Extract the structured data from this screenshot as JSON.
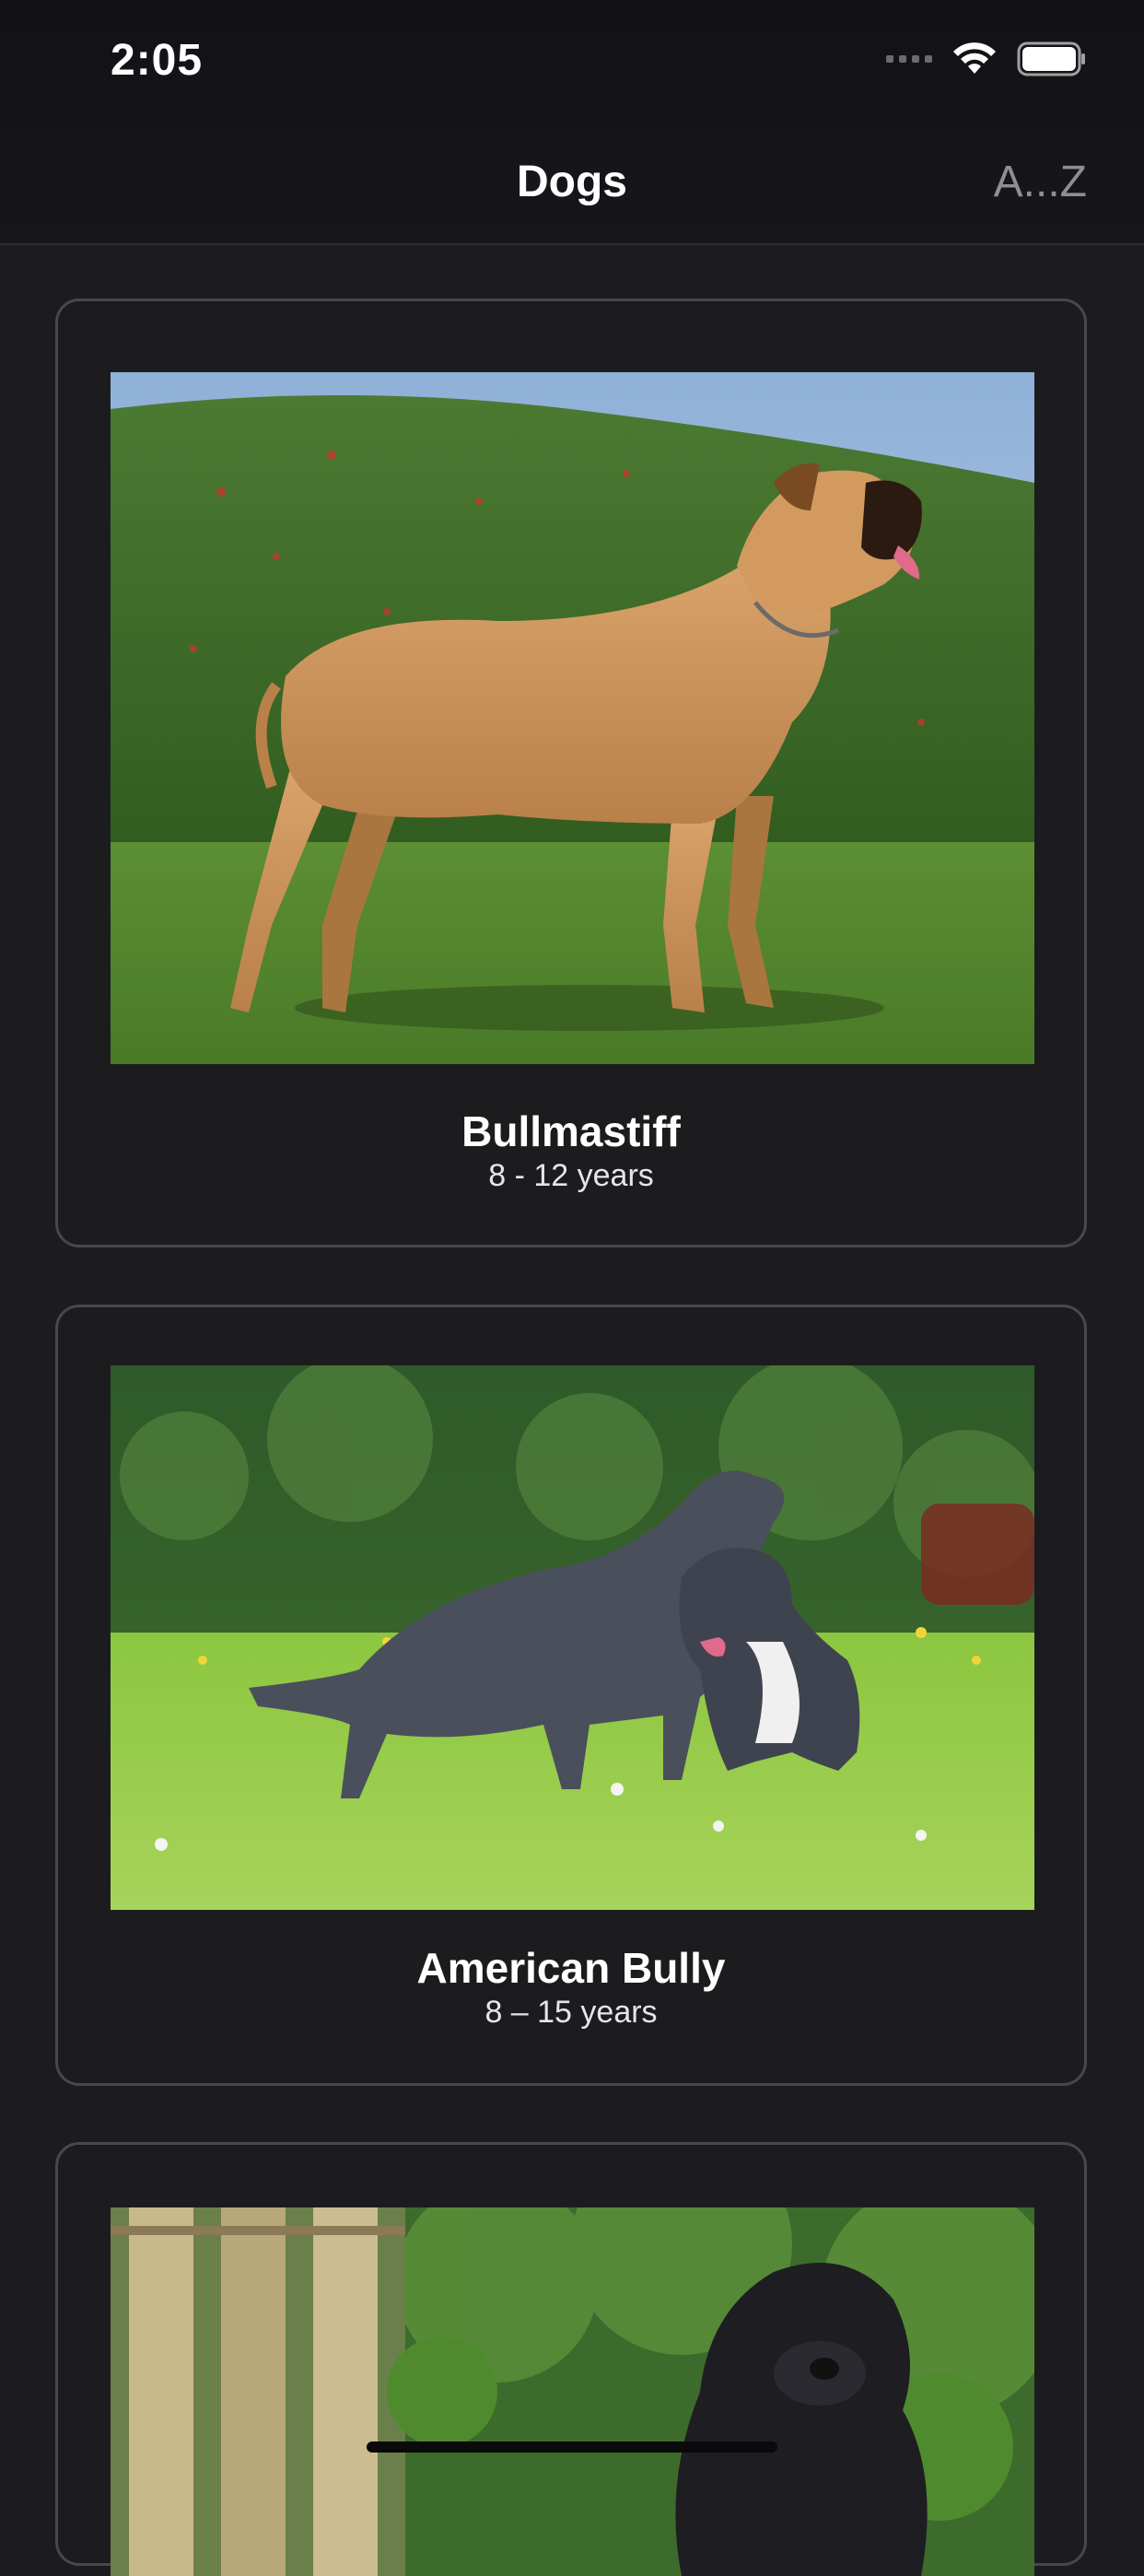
{
  "status_bar": {
    "time": "2:05"
  },
  "nav": {
    "title": "Dogs",
    "sort_label": "A...Z"
  },
  "breeds": [
    {
      "name": "Bullmastiff",
      "life_span": "8 - 12 years",
      "photo": "bullmastiff-photo"
    },
    {
      "name": "American Bully",
      "life_span": "8 – 15 years",
      "photo": "american-bully-photo"
    },
    {
      "name": "",
      "life_span": "",
      "photo": "black-curly-dog-photo"
    }
  ],
  "colors": {
    "background": "#1c1c1e",
    "card_border": "#48484a",
    "muted_text": "#8e8e93"
  }
}
